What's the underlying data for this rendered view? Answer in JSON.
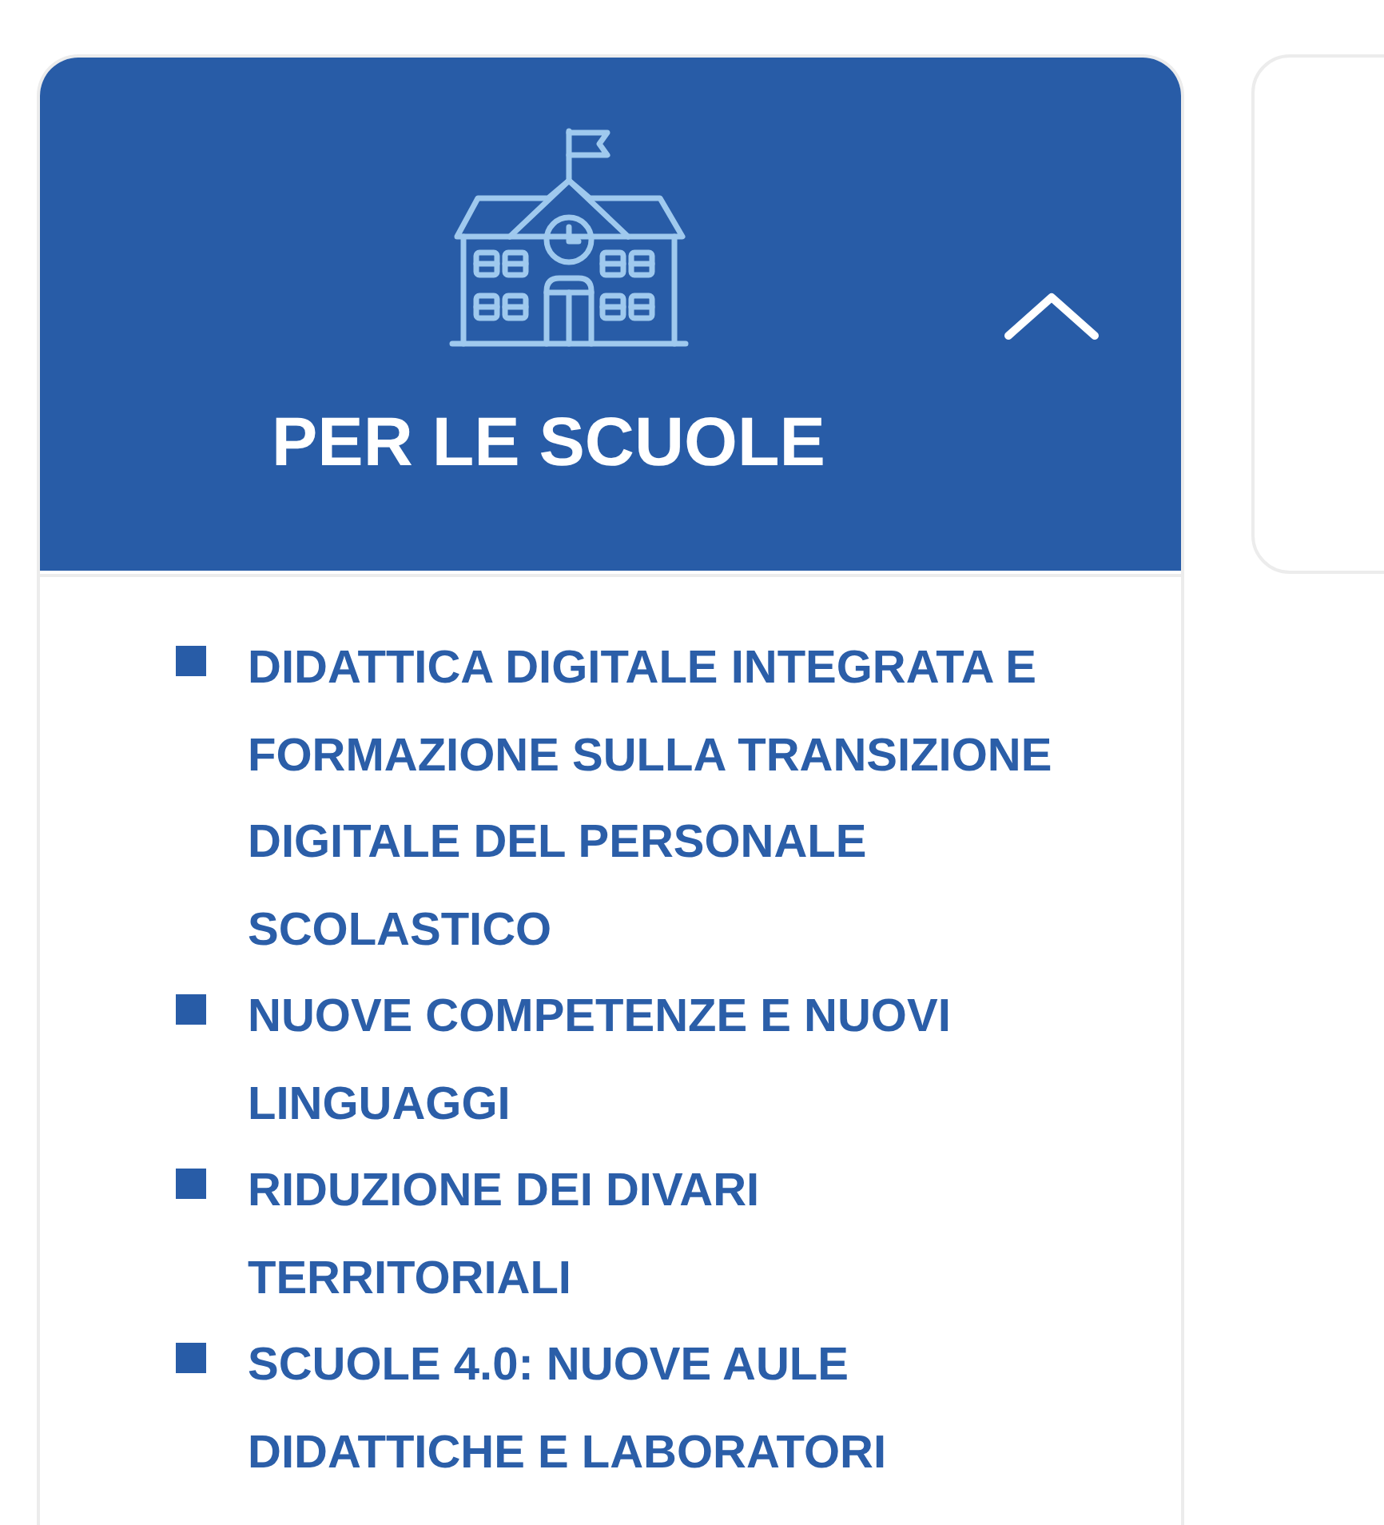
{
  "section": {
    "title": "PER LE SCUOLE",
    "expanded": true,
    "items": [
      {
        "label": "DIDATTICA DIGITALE INTEGRATA E FORMAZIONE SULLA TRANSIZIONE DIGITALE DEL PERSONALE SCOLASTICO"
      },
      {
        "label": "NUOVE COMPETENZE E NUOVI LINGUAGGI"
      },
      {
        "label": "RIDUZIONE DEI DIVARI TERRITORIALI"
      },
      {
        "label": "SCUOLE 4.0: NUOVE AULE DIDATTICHE E LABORATORI"
      }
    ]
  }
}
